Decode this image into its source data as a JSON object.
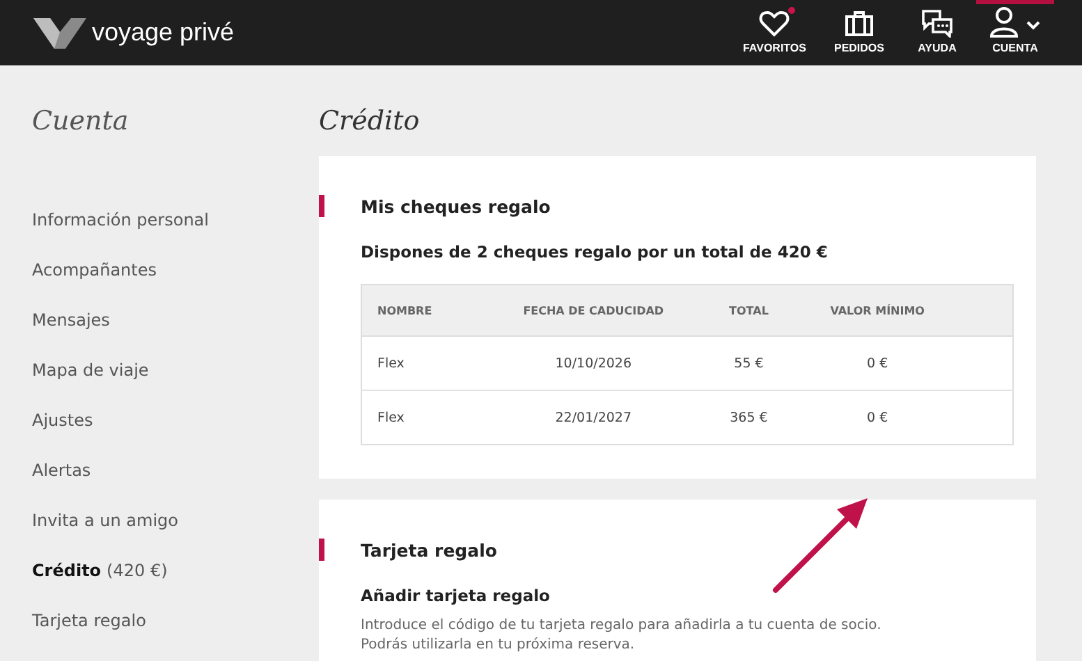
{
  "header": {
    "brand": "voyage privé",
    "nav": [
      {
        "label": "FAVORITOS",
        "kind": "heart",
        "notification": true,
        "selected": false
      },
      {
        "label": "PEDIDOS",
        "kind": "suitcase",
        "notification": false,
        "selected": false
      },
      {
        "label": "AYUDA",
        "kind": "chat",
        "notification": false,
        "selected": false
      },
      {
        "label": "CUENTA",
        "kind": "user",
        "notification": false,
        "selected": true
      }
    ]
  },
  "sidebar": {
    "title": "Cuenta",
    "items": [
      {
        "label": "Información personal",
        "selected": false
      },
      {
        "label": "Acompañantes",
        "selected": false
      },
      {
        "label": "Mensajes",
        "selected": false
      },
      {
        "label": "Mapa de viaje",
        "selected": false
      },
      {
        "label": "Ajustes",
        "selected": false
      },
      {
        "label": "Alertas",
        "selected": false
      },
      {
        "label": "Invita a un amigo",
        "selected": false
      },
      {
        "label": "Crédito",
        "suffix": "(420 €)",
        "selected": true
      },
      {
        "label": "Tarjeta regalo",
        "selected": false
      }
    ]
  },
  "page_title": "Crédito",
  "cheques": {
    "heading": "Mis cheques regalo",
    "summary": "Dispones de 2 cheques regalo por un total de 420 €",
    "table": {
      "columns": [
        "NOMBRE",
        "FECHA DE CADUCIDAD",
        "TOTAL",
        "VALOR MÍNIMO"
      ],
      "rows": [
        [
          "Flex",
          "10/10/2026",
          "55 €",
          "0 €"
        ],
        [
          "Flex",
          "22/01/2027",
          "365 €",
          "0 €"
        ]
      ]
    }
  },
  "gift_card": {
    "heading": "Tarjeta regalo",
    "subheading": "Añadir tarjeta regalo",
    "text": "Introduce el código de tu tarjeta regalo para añadirla a tu cuenta de socio.",
    "text_2": "Podrás utilizarla en tu próxima reserva."
  }
}
